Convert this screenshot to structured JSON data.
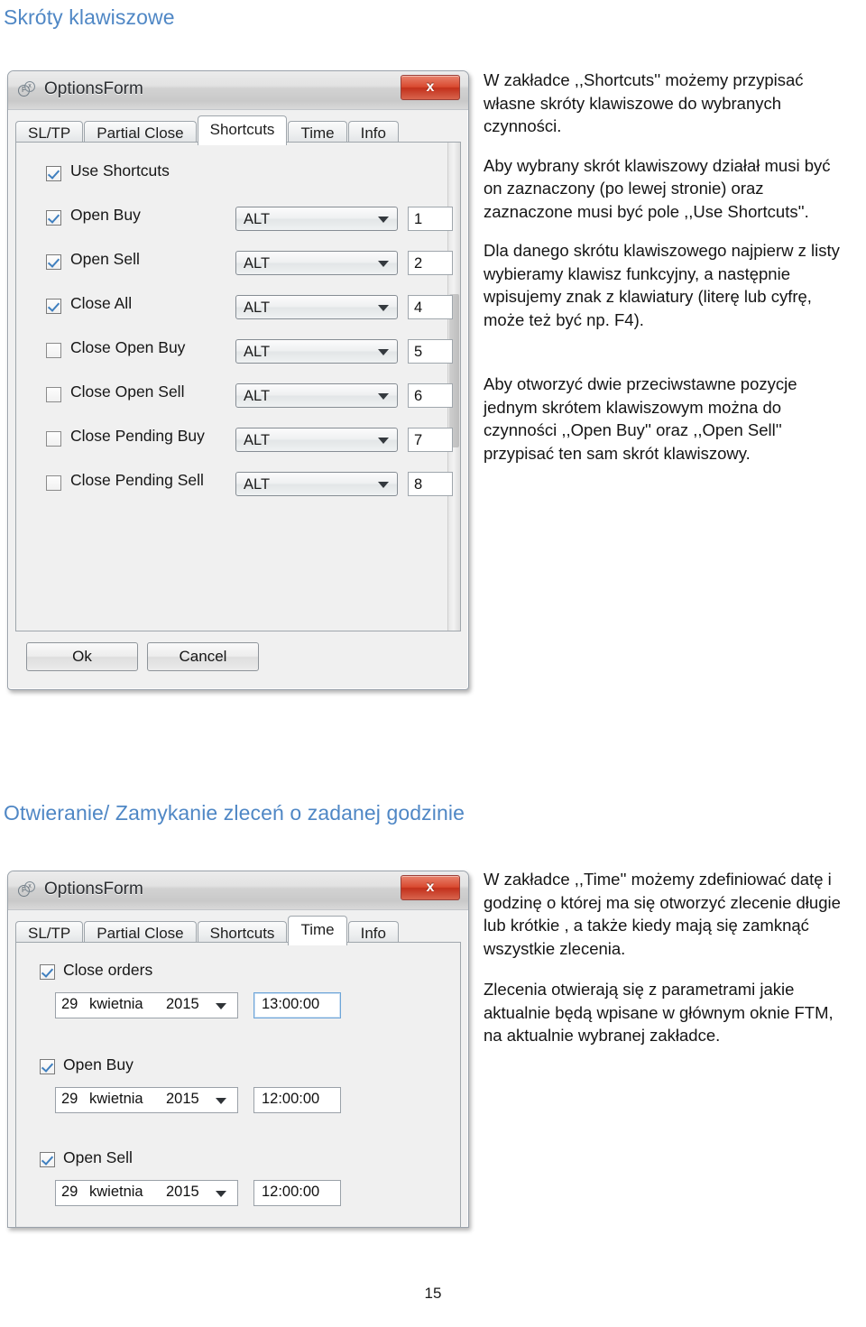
{
  "document": {
    "page_number": "15",
    "heading_color": "#4f87c5",
    "headings": {
      "section1": "Skróty klawiszowe",
      "section2": "Otwieranie/ Zamykanie zleceń o zadanej godzinie"
    }
  },
  "section1": {
    "paragraphs": [
      "W zakładce ,,Shortcuts'' możemy przypisać własne skróty klawiszowe do wybranych czynności.",
      "Aby wybrany skrót klawiszowy działał musi być on zaznaczony (po lewej stronie) oraz zaznaczone musi być pole ,,Use Shortcuts''.",
      "Dla danego skrótu klawiszowego najpierw z listy wybieramy klawisz funkcyjny, a następnie wpisujemy znak z klawiatury (literę lub cyfrę, może też być np. F4).",
      "Aby otworzyć dwie przeciwstawne pozycje jednym skrótem klawiszowym można do czynności  ,,Open Buy'' oraz ,,Open Sell'' przypisać ten sam skrót klawiszowy."
    ]
  },
  "section2": {
    "paragraphs": [
      "W zakładce ,,Time'' możemy zdefiniować datę i godzinę o której ma się otworzyć zlecenie długie lub krótkie , a także kiedy mają się zamknąć wszystkie zlecenia.",
      "Zlecenia otwierają się z parametrami jakie aktualnie będą wpisane w głównym oknie FTM, na aktualnie wybranej zakładce."
    ]
  },
  "dialog_shortcuts": {
    "title": "OptionsForm",
    "close_label": "x",
    "tabs": [
      {
        "label": "SL/TP",
        "active": false
      },
      {
        "label": "Partial Close",
        "active": false
      },
      {
        "label": "Shortcuts",
        "active": true
      },
      {
        "label": "Time",
        "active": false
      },
      {
        "label": "Info",
        "active": false
      }
    ],
    "use_shortcuts": {
      "label": "Use Shortcuts",
      "checked": true
    },
    "rows": [
      {
        "label": "Open Buy",
        "checked": true,
        "modifier": "ALT",
        "key": "1"
      },
      {
        "label": "Open Sell",
        "checked": true,
        "modifier": "ALT",
        "key": "2"
      },
      {
        "label": "Close All",
        "checked": true,
        "modifier": "ALT",
        "key": "4"
      },
      {
        "label": "Close Open Buy",
        "checked": false,
        "modifier": "ALT",
        "key": "5"
      },
      {
        "label": "Close Open Sell",
        "checked": false,
        "modifier": "ALT",
        "key": "6"
      },
      {
        "label": "Close Pending Buy",
        "checked": false,
        "modifier": "ALT",
        "key": "7"
      },
      {
        "label": "Close Pending Sell",
        "checked": false,
        "modifier": "ALT",
        "key": "8"
      }
    ],
    "buttons": {
      "ok": "Ok",
      "cancel": "Cancel"
    }
  },
  "dialog_time": {
    "title": "OptionsForm",
    "close_label": "x",
    "tabs": [
      {
        "label": "SL/TP",
        "active": false
      },
      {
        "label": "Partial Close",
        "active": false
      },
      {
        "label": "Shortcuts",
        "active": false
      },
      {
        "label": "Time",
        "active": true
      },
      {
        "label": "Info",
        "active": false
      }
    ],
    "groups": [
      {
        "label": "Close orders",
        "checked": true,
        "day": "29",
        "month": "kwietnia",
        "year": "2015",
        "time": "13:00:00",
        "time_focused": true
      },
      {
        "label": "Open Buy",
        "checked": true,
        "day": "29",
        "month": "kwietnia",
        "year": "2015",
        "time": "12:00:00",
        "time_focused": false
      },
      {
        "label": "Open Sell",
        "checked": true,
        "day": "29",
        "month": "kwietnia",
        "year": "2015",
        "time": "12:00:00",
        "time_focused": false
      }
    ]
  }
}
